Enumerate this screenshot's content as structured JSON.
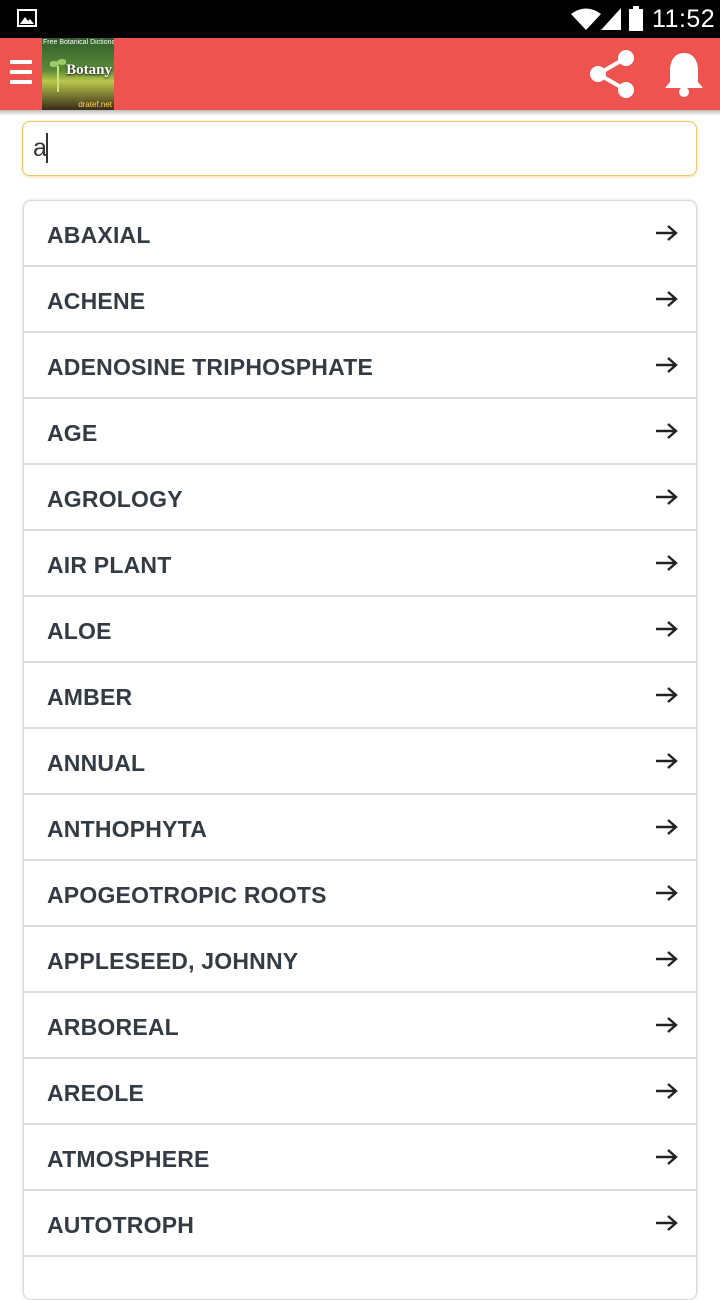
{
  "status_bar": {
    "time": "11:52",
    "icons": [
      "gallery-icon",
      "wifi-icon",
      "signal-icon",
      "battery-icon"
    ]
  },
  "app_bar": {
    "color": "#ef5350",
    "logo": {
      "top_text": "Free Botanical Dictionary",
      "title": "Botany",
      "site": "dratef.net"
    },
    "icons": [
      "menu-icon",
      "share-icon",
      "bell-icon"
    ]
  },
  "search": {
    "value": "a",
    "placeholder": ""
  },
  "results": {
    "items": [
      {
        "label": "ABAXIAL"
      },
      {
        "label": "ACHENE"
      },
      {
        "label": "ADENOSINE TRIPHOSPHATE"
      },
      {
        "label": "AGE"
      },
      {
        "label": "AGROLOGY"
      },
      {
        "label": "AIR PLANT"
      },
      {
        "label": "ALOE"
      },
      {
        "label": "AMBER"
      },
      {
        "label": "ANNUAL"
      },
      {
        "label": "ANTHOPHYTA"
      },
      {
        "label": "APOGEOTROPIC ROOTS"
      },
      {
        "label": "APPLESEED, JOHNNY"
      },
      {
        "label": "ARBOREAL"
      },
      {
        "label": "AREOLE"
      },
      {
        "label": "ATMOSPHERE"
      },
      {
        "label": "AUTOTROPH"
      }
    ],
    "arrow_icon": "arrow-right-icon"
  }
}
